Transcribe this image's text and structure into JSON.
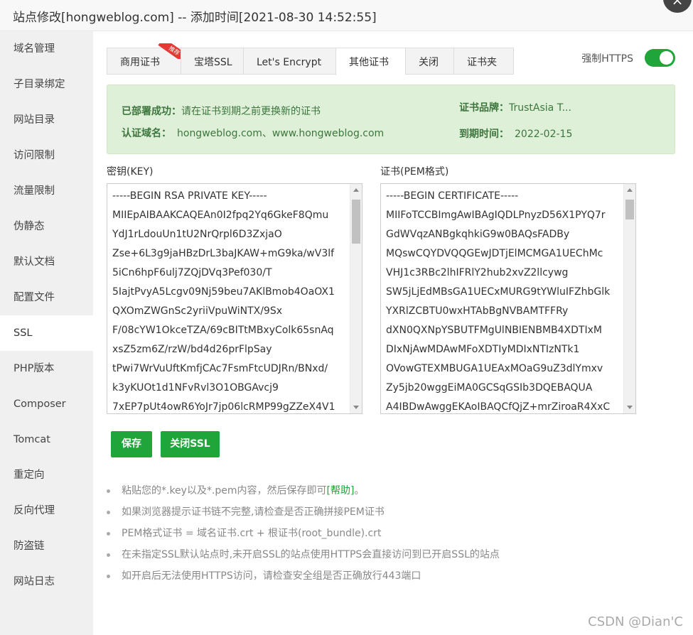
{
  "window": {
    "title": "站点修改[hongweblog.com] -- 添加时间[2021-08-30 14:52:55]",
    "close_glyph": "×"
  },
  "sidebar": {
    "items": [
      {
        "label": "域名管理"
      },
      {
        "label": "子目录绑定"
      },
      {
        "label": "网站目录"
      },
      {
        "label": "访问限制"
      },
      {
        "label": "流量限制"
      },
      {
        "label": "伪静态"
      },
      {
        "label": "默认文档"
      },
      {
        "label": "配置文件"
      },
      {
        "label": "SSL"
      },
      {
        "label": "PHP版本"
      },
      {
        "label": "Composer"
      },
      {
        "label": "Tomcat"
      },
      {
        "label": "重定向"
      },
      {
        "label": "反向代理"
      },
      {
        "label": "防盗链"
      },
      {
        "label": "网站日志"
      }
    ],
    "active_index": 8
  },
  "tabs": [
    {
      "label": "商用证书",
      "badge": "推荐"
    },
    {
      "label": "宝塔SSL"
    },
    {
      "label": "Let's Encrypt"
    },
    {
      "label": "其他证书"
    },
    {
      "label": "关闭"
    },
    {
      "label": "证书夹"
    }
  ],
  "https": {
    "label": "强制HTTPS",
    "enabled": true
  },
  "status": {
    "deployed_label": "已部署成功：",
    "deployed_value": "请在证书到期之前更换新的证书",
    "domain_label": "认证域名：",
    "domain_value": "hongweblog.com、www.hongweblog.com",
    "brand_label": "证书品牌：",
    "brand_value": "TrustAsia T...",
    "expire_label": "到期时间：",
    "expire_value": "2022-02-15"
  },
  "key_editor": {
    "title": "密钥(KEY)",
    "lines": [
      "-----BEGIN RSA PRIVATE KEY-----",
      "MIIEpAIBAAKCAQEAn0I2fpq2Yq6GkeF8Qmu",
      "YdJ1rLdouUn1tU2NrQrpl6D3ZxjaO",
      "Zse+6L3g9jaHBzDrL3baJKAW+mG9ka/wV3lf",
      "5iCn6hpF6ulj7ZQjDVq3Pef030/T",
      "5IajtPvyA5Lcgv09Nj59beu7AKlBmob4OaOX1",
      "QXOmZWGnSc2yriiVpuWiNTX/9Sx",
      "F/08cYW1OkceTZA/69cBITtMBxyColk65snAq",
      "xsZ5zm6Z/rzW/bd4d26prFlpSay",
      "tPwi7WrVuUftKmfjCAc7FsmFtcUDJRn/BNxd/",
      "k3yKUOt1d1NFvRvl3O1OBGAvcj9",
      "7xEP7pUt4owR6YoJr7jp06lcRMP99gZZeX4V1"
    ]
  },
  "cert_editor": {
    "title": "证书(PEM格式)",
    "lines": [
      "-----BEGIN CERTIFICATE-----",
      "MIIFoTCCBImgAwIBAgIQDLPnyzD56X1PYQ7r",
      "GdWVqzANBgkqhkiG9w0BAQsFADBy",
      "MQswCQYDVQQGEwJDTjElMCMGA1UEChMc",
      "VHJ1c3RBc2lhIFRlY2hub2xvZ2llcywg",
      "SW5jLjEdMBsGA1UECxMURG9tYWluIFZhbGlk",
      "YXRlZCBTU0wxHTAbBgNVBAMTFFRy",
      "dXN0QXNpYSBUTFMgUlNBIENBMB4XDTIxM",
      "DIxNjAwMDAwMFoXDTIyMDIxNTIzNTk1",
      "OVowGTEXMBUGA1UEAxMOaG9uZ3dlYmxv",
      "Zy5jb20wggEiMA0GCSqGSIb3DQEBAQUA",
      "A4IBDwAwggEKAoIBAQCfQjZ+mrZiroaR4XxC"
    ]
  },
  "buttons": {
    "save": "保存",
    "close_ssl": "关闭SSL"
  },
  "tips": {
    "tip1_text": "粘贴您的*.key以及*.pem内容，然后保存即可",
    "tip1_link": "[帮助]",
    "tip1_tail": "。",
    "tip2": "如果浏览器提示证书链不完整,请检查是否正确拼接PEM证书",
    "tip3": "PEM格式证书 = 域名证书.crt + 根证书(root_bundle).crt",
    "tip4": "在未指定SSL默认站点时,未开启SSL的站点使用HTTPS会直接访问到已开启SSL的站点",
    "tip5": "如开启后无法使用HTTPS访问，请检查安全组是否正确放行443端口"
  },
  "watermark": "CSDN @Dian'C"
}
